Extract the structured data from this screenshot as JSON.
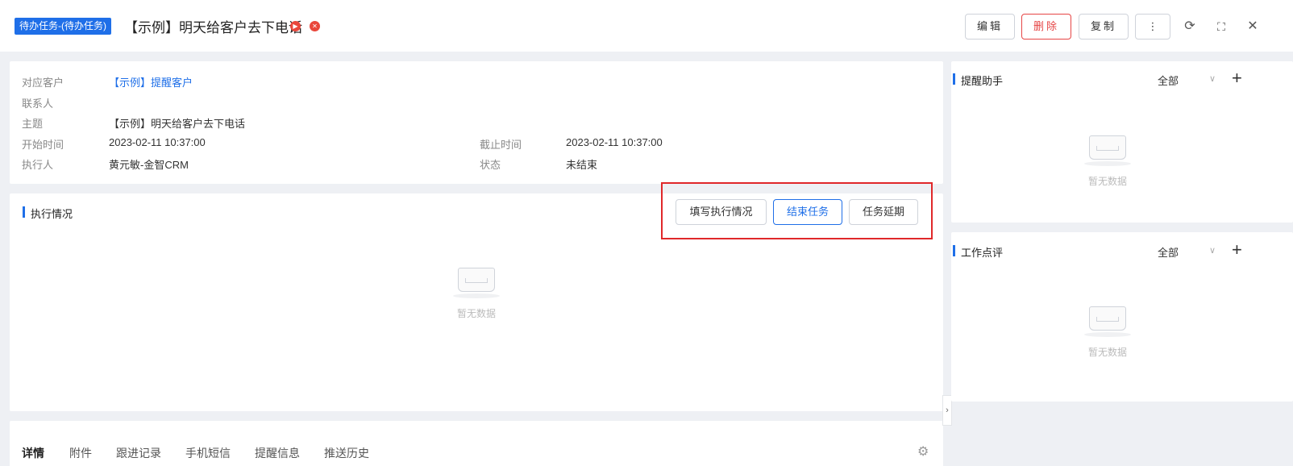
{
  "header": {
    "tag": "待办任务-(待办任务)",
    "title": "【示例】明天给客户去下电话",
    "buttons": {
      "edit": "编辑",
      "delete": "删除",
      "copy": "复制",
      "more": "⋮"
    },
    "icons": {
      "refresh": "⟳",
      "fullscreen": "⛶",
      "close": "✕"
    }
  },
  "info": {
    "customer_label": "对应客户",
    "customer_value": "【示例】提醒客户",
    "contact_label": "联系人",
    "subject_label": "主题",
    "subject_value": "【示例】明天给客户去下电话",
    "start_label": "开始时间",
    "start_value": "2023-02-11 10:37:00",
    "deadline_label": "截止时间",
    "deadline_value": "2023-02-11 10:37:00",
    "executor_label": "执行人",
    "executor_value": "黄元敏-金智CRM",
    "status_label": "状态",
    "status_value": "未结束"
  },
  "execution": {
    "title": "执行情况",
    "fill_btn": "填写执行情况",
    "finish_btn": "结束任务",
    "delay_btn": "任务延期",
    "empty": "暂无数据"
  },
  "tabs": [
    "详情",
    "附件",
    "跟进记录",
    "手机短信",
    "提醒信息",
    "推送历史"
  ],
  "reminder": {
    "title": "提醒助手",
    "filter": "全部",
    "empty": "暂无数据"
  },
  "review": {
    "title": "工作点评",
    "filter": "全部",
    "empty": "暂无数据"
  },
  "colors": {
    "primary": "#1f6fe8",
    "danger": "#e64545",
    "highlight": "#e0282a"
  }
}
